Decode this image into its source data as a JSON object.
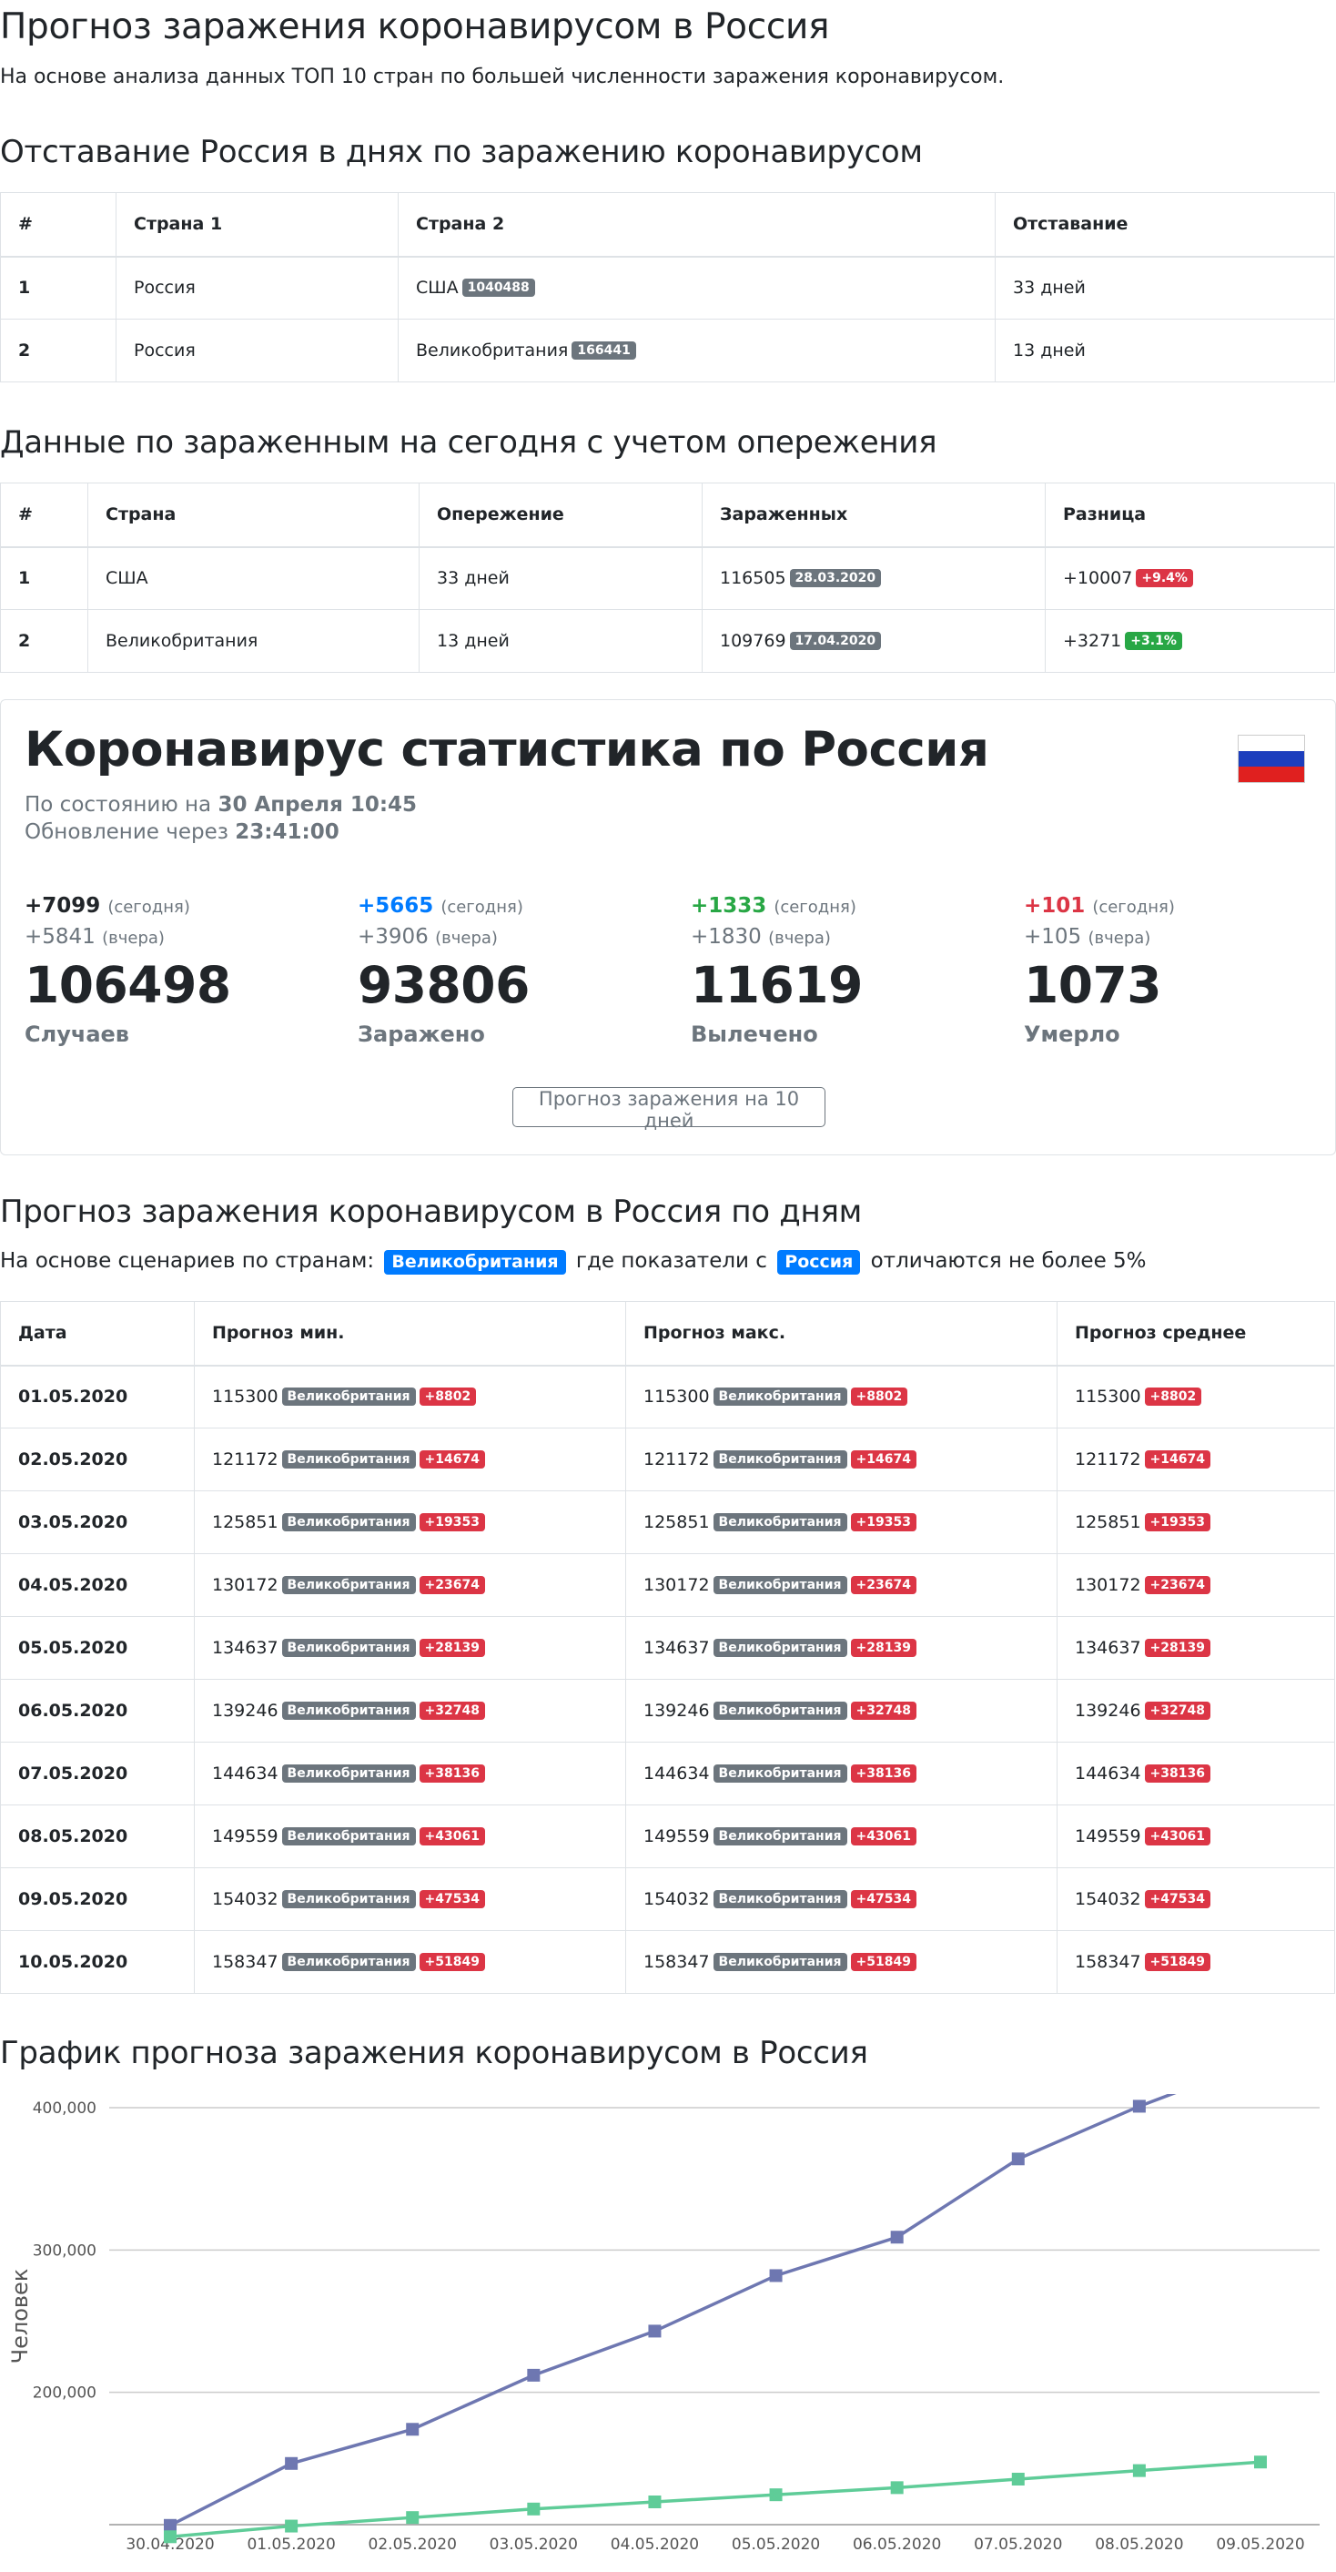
{
  "page": {
    "title": "Прогноз заражения коронавирусом в Россия",
    "lead": "На основе анализа данных ТОП 10 стран по большей численности заражения коронавирусом."
  },
  "lag_section": {
    "title": "Отставание Россия в днях по заражению коронавирусом",
    "headers": [
      "#",
      "Страна 1",
      "Страна 2",
      "Отставание"
    ],
    "rows": [
      {
        "n": "1",
        "c1": "Россия",
        "c2": "США",
        "c2_badge": "1040488",
        "lag": "33 дней"
      },
      {
        "n": "2",
        "c1": "Россия",
        "c2": "Великобритания",
        "c2_badge": "166441",
        "lag": "13 дней"
      }
    ]
  },
  "today_section": {
    "title": "Данные по зараженным на сегодня с учетом опережения",
    "headers": [
      "#",
      "Страна",
      "Опережение",
      "Зараженных",
      "Разница"
    ],
    "rows": [
      {
        "n": "1",
        "country": "США",
        "ahead": "33 дней",
        "infected": "116505",
        "date": "28.03.2020",
        "diff": "+10007",
        "pct": "+9.4%",
        "pct_color": "#dc3545"
      },
      {
        "n": "2",
        "country": "Великобритания",
        "ahead": "13 дней",
        "infected": "109769",
        "date": "17.04.2020",
        "diff": "+3271",
        "pct": "+3.1%",
        "pct_color": "#28a745"
      }
    ]
  },
  "stats_card": {
    "title": "Коронавирус статистика по Россия",
    "state_prefix": "По состоянию на",
    "state_date": "30 Апреля 10:45",
    "update_prefix": "Обновление через",
    "update_time": "23:41:00",
    "today_word": "(сегодня)",
    "yesterday_word": "(вчера)",
    "items": [
      {
        "today": "+7099",
        "yesterday": "+5841",
        "value": "106498",
        "label": "Случаев",
        "color": "#212529"
      },
      {
        "today": "+5665",
        "yesterday": "+3906",
        "value": "93806",
        "label": "Заражено",
        "color": "#007bff"
      },
      {
        "today": "+1333",
        "yesterday": "+1830",
        "value": "11619",
        "label": "Вылечено",
        "color": "#28a745"
      },
      {
        "today": "+101",
        "yesterday": "+105",
        "value": "1073",
        "label": "Умерло",
        "color": "#dc3545"
      }
    ],
    "forecast_button": "Прогноз заражения на 10 дней",
    "flag_colors": [
      "#ffffff",
      "#1c3ebd",
      "#e0201f"
    ]
  },
  "forecast_section": {
    "title": "Прогноз заражения коронавирусом в Россия по дням",
    "scenario_prefix": "На основе сценариев по странам:",
    "scenario_country": "Великобритания",
    "scenario_mid": "где показатели с",
    "scenario_self": "Россия",
    "scenario_suffix": "отличаются не более 5%",
    "headers": [
      "Дата",
      "Прогноз мин.",
      "Прогноз макс.",
      "Прогноз среднее"
    ],
    "country_badge": "Великобритания",
    "rows": [
      {
        "date": "01.05.2020",
        "min": "115300",
        "max": "115300",
        "avg": "115300",
        "delta": "+8802"
      },
      {
        "date": "02.05.2020",
        "min": "121172",
        "max": "121172",
        "avg": "121172",
        "delta": "+14674"
      },
      {
        "date": "03.05.2020",
        "min": "125851",
        "max": "125851",
        "avg": "125851",
        "delta": "+19353"
      },
      {
        "date": "04.05.2020",
        "min": "130172",
        "max": "130172",
        "avg": "130172",
        "delta": "+23674"
      },
      {
        "date": "05.05.2020",
        "min": "134637",
        "max": "134637",
        "avg": "134637",
        "delta": "+28139"
      },
      {
        "date": "06.05.2020",
        "min": "139246",
        "max": "139246",
        "avg": "139246",
        "delta": "+32748"
      },
      {
        "date": "07.05.2020",
        "min": "144634",
        "max": "144634",
        "avg": "144634",
        "delta": "+38136"
      },
      {
        "date": "08.05.2020",
        "min": "149559",
        "max": "149559",
        "avg": "149559",
        "delta": "+43061"
      },
      {
        "date": "09.05.2020",
        "min": "154032",
        "max": "154032",
        "avg": "154032",
        "delta": "+47534"
      },
      {
        "date": "10.05.2020",
        "min": "158347",
        "max": "158347",
        "avg": "158347",
        "delta": "+51849"
      }
    ]
  },
  "chart_section": {
    "title": "График прогноза заражения коронавирусом в Россия"
  },
  "chart_data": {
    "type": "line",
    "title": "",
    "xlabel": "",
    "ylabel": "Человек",
    "categories": [
      "30.04.2020",
      "01.05.2020",
      "02.05.2020",
      "03.05.2020",
      "04.05.2020",
      "05.05.2020",
      "06.05.2020",
      "07.05.2020",
      "08.05.2020",
      "09.05.2020"
    ],
    "yticks": [
      "200,000",
      "300,000",
      "400,000"
    ],
    "ylim": [
      107000,
      400000
    ],
    "grid": true,
    "series": [
      {
        "color": "#6e77b1",
        "values": [
          106498,
          150000,
          174000,
          212000,
          243000,
          282000,
          309000,
          364000,
          401000,
          433000
        ]
      },
      {
        "color": "#5fcc98",
        "values": [
          98500,
          106000,
          112000,
          118000,
          123000,
          128000,
          133000,
          139000,
          145000,
          151000
        ]
      }
    ]
  }
}
